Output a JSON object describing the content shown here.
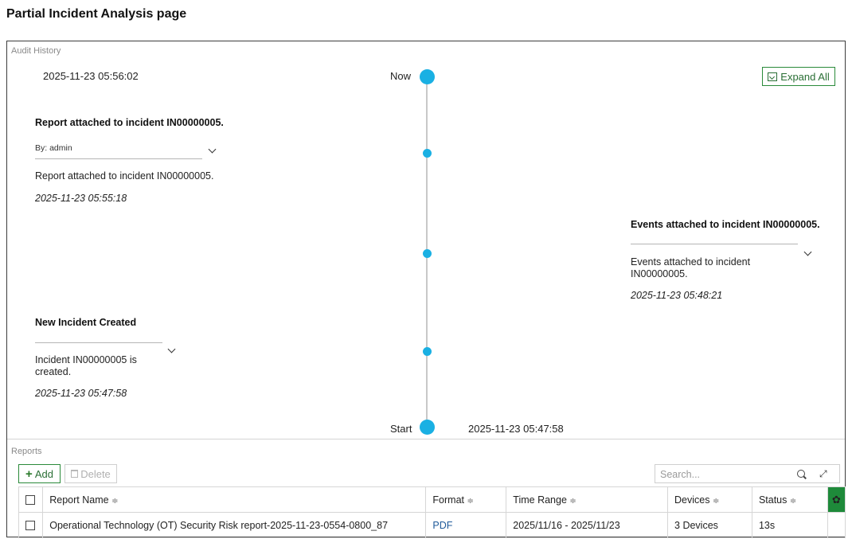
{
  "page_title": "Partial Incident Analysis page",
  "audit_history": {
    "label": "Audit History",
    "expand_all_label": "Expand All",
    "timeline": {
      "now_label": "Now",
      "now_time": "2025-11-23 05:56:02",
      "start_label": "Start",
      "start_time": "2025-11-23 05:47:58"
    },
    "entries": [
      {
        "title": "Report attached to incident IN00000005.",
        "by": "By: admin",
        "description": "Report attached to incident IN00000005.",
        "time": "2025-11-23 05:55:18"
      },
      {
        "title": "Events attached to incident IN00000005.",
        "description_line1": "Events attached to incident",
        "description_line2": "IN00000005.",
        "time": "2025-11-23 05:48:21"
      },
      {
        "title": "New Incident Created",
        "description_line1": "Incident IN00000005 is",
        "description_line2": "created.",
        "time": "2025-11-23 05:47:58"
      }
    ]
  },
  "reports": {
    "label": "Reports",
    "add_label": "Add",
    "delete_label": "Delete",
    "search_placeholder": "Search...",
    "columns": [
      "Report Name",
      "Format",
      "Time Range",
      "Devices",
      "Status"
    ],
    "sort_glyph": "≑",
    "rows": [
      {
        "name": "Operational Technology (OT) Security Risk report-2025-11-23-0554-0800_87",
        "format": "PDF",
        "time_range": "2025/11/16 - 2025/11/23",
        "devices": "3 Devices",
        "status": "13s"
      }
    ]
  },
  "icons": {
    "expand": "expand-all-icon",
    "add": "plus-icon",
    "delete": "trash-icon",
    "search": "search-icon",
    "fullscreen": "expand-icon",
    "settings": "gear-icon"
  },
  "colors": {
    "timeline_dot": "#1ab0e3",
    "accent_green": "#1e8a3a",
    "link_blue": "#1f5a9a"
  }
}
